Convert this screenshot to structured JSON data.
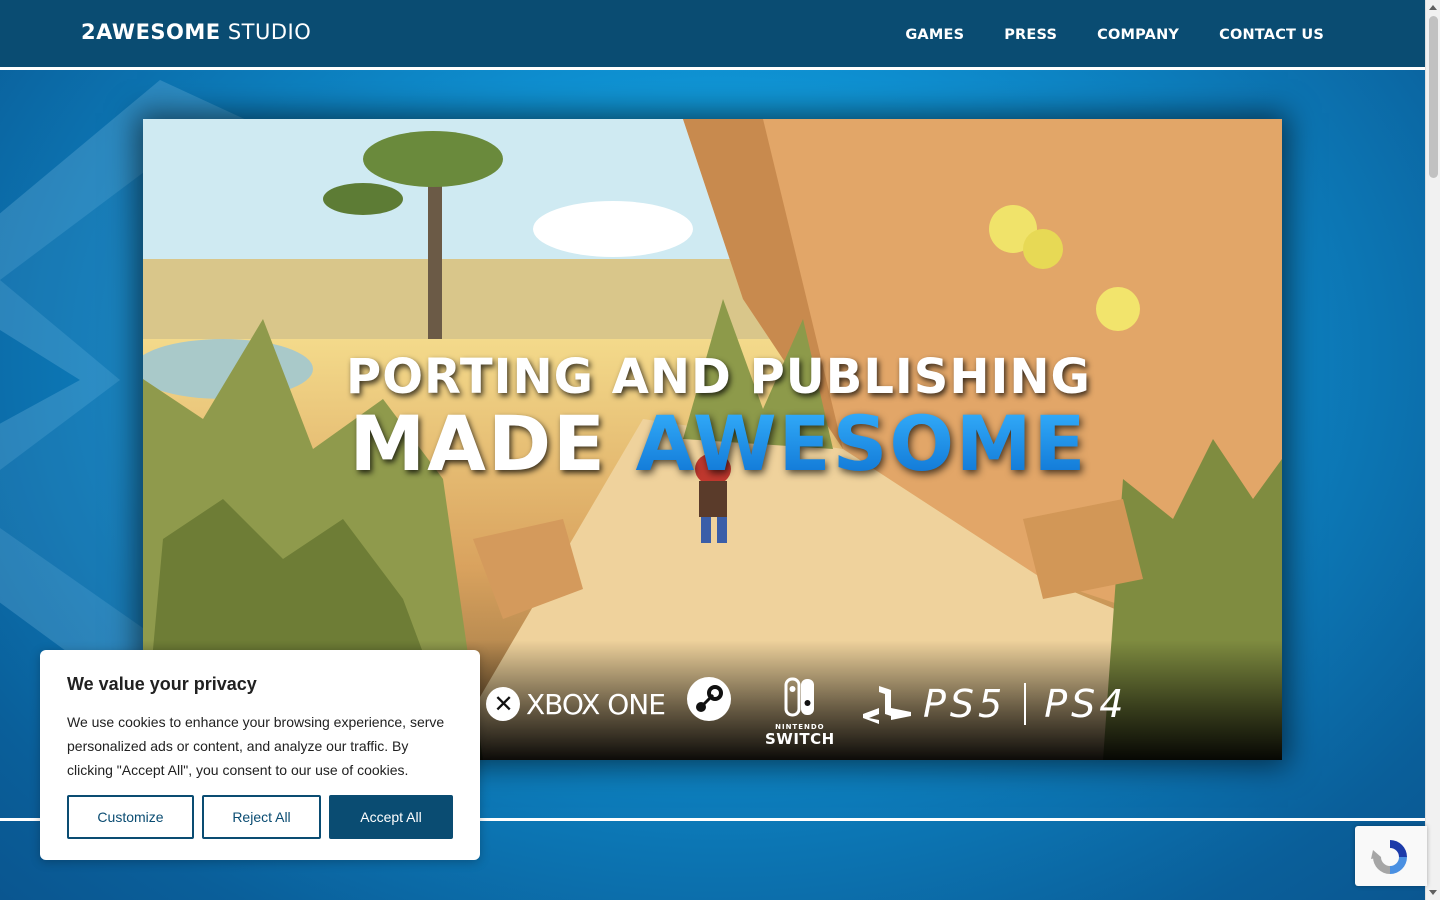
{
  "header": {
    "logo_bold": "2AWESOME",
    "logo_light": "STUDIO",
    "nav": [
      "GAMES",
      "PRESS",
      "COMPANY",
      "CONTACT US"
    ]
  },
  "hero": {
    "headline_line1": "PORTING AND PUBLISHING",
    "headline_made": "MADE",
    "headline_awesome": "AWESOME",
    "platforms": {
      "xbox": "XBOX ONE",
      "switch_small": "NINTENDO",
      "switch_big": "SWITCH",
      "ps5": "PS5",
      "ps4": "PS4"
    }
  },
  "cookie_banner": {
    "title": "We value your privacy",
    "body": "We use cookies to enhance your browsing experience, serve personalized ads or content, and analyze our traffic. By clicking \"Accept All\", you consent to our use of cookies.",
    "customize_label": "Customize",
    "reject_label": "Reject All",
    "accept_label": "Accept All"
  },
  "colors": {
    "header_bg": "#0a4c72",
    "accent_blue": "#0b6fd0",
    "page_bg": "#0f8fd0"
  },
  "icons": [
    "xbox-icon",
    "steam-icon",
    "nintendo-switch-icon",
    "playstation-icon",
    "recaptcha-icon"
  ]
}
